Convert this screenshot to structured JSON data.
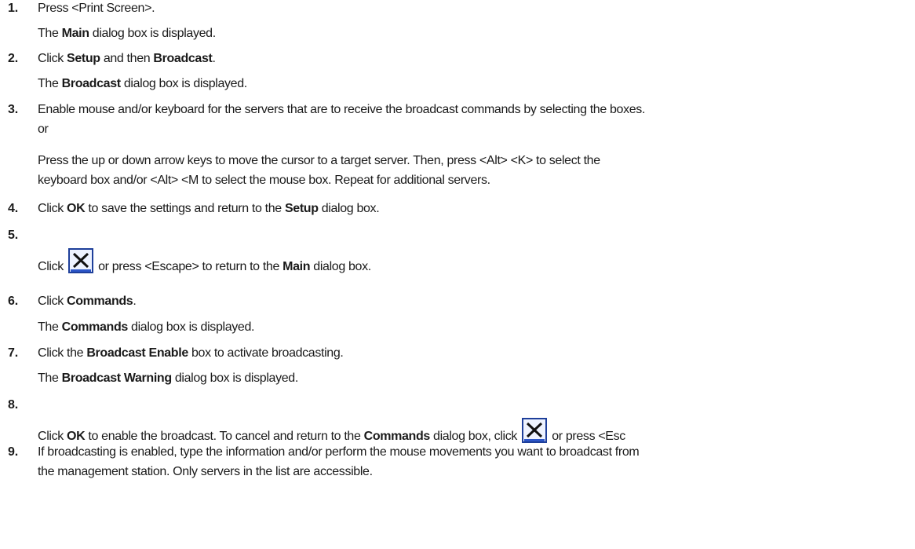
{
  "steps": [
    {
      "number": "1.",
      "line1": "Press <Print Screen>.",
      "sub": {
        "pre": "The ",
        "b1": "Main",
        "post": " dialog box is displayed."
      }
    },
    {
      "number": "2.",
      "line1": {
        "pre": "Click ",
        "b1": "Setup",
        "mid": " and then ",
        "b2": "Broadcast",
        "post": "."
      },
      "sub": {
        "pre": "The ",
        "b1": "Broadcast",
        "post": " dialog box is displayed."
      }
    },
    {
      "number": "3.",
      "line1": "Enable mouse and/or keyboard for the servers that are to receive the broadcast commands by selecting the boxes.",
      "or": "or",
      "para1": "Press the up or down arrow keys to move the cursor to a target server. Then, press <Alt> <K> to select the",
      "para2": "keyboard box and/or <Alt> <M to select the mouse box. Repeat for additional servers."
    },
    {
      "number": "4.",
      "line1": {
        "pre": "Click ",
        "b1": "OK",
        "mid": " to save the settings and return to the ",
        "b2": "Setup",
        "post": " dialog box."
      }
    },
    {
      "number": "5.",
      "line1": {
        "pre": "Click ",
        "post1": " or press <Escape> to return to the ",
        "b1": "Main",
        "post2": " dialog box."
      }
    },
    {
      "number": "6.",
      "line1": {
        "pre": "Click ",
        "b1": "Commands",
        "post": "."
      },
      "sub": {
        "pre": "The ",
        "b1": "Commands",
        "post": " dialog box is displayed."
      }
    },
    {
      "number": "7.",
      "line1": {
        "pre": "Click the ",
        "b1": "Broadcast Enable",
        "post": " box to activate broadcasting."
      },
      "sub": {
        "pre": "The ",
        "b1": "Broadcast Warning",
        "post": " dialog box is displayed."
      }
    },
    {
      "number": "8.",
      "line1": {
        "pre": "Click ",
        "b1": "OK",
        "mid": " to enable the broadcast. To cancel and return to the ",
        "b2": "Commands",
        "mid2": " dialog box, click ",
        "post": " or press <Esc"
      }
    },
    {
      "number": "9.",
      "line1": "If broadcasting is enabled, type the information and/or perform the mouse movements you want to broadcast from",
      "line2": "the management station. Only servers in the list are accessible."
    }
  ],
  "icons": {
    "close_icon": "close-icon",
    "accent": "#2b55c8",
    "frame": "#1e3f9a"
  }
}
